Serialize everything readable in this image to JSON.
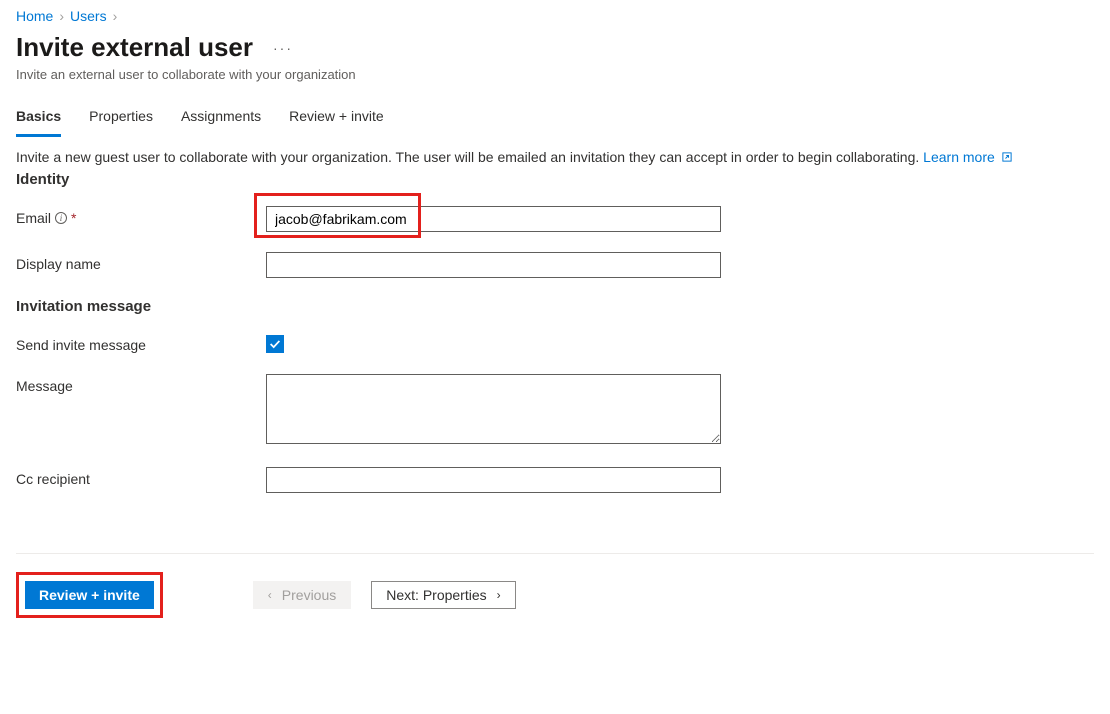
{
  "breadcrumb": {
    "home": "Home",
    "users": "Users"
  },
  "header": {
    "title": "Invite external user",
    "subtitle": "Invite an external user to collaborate with your organization"
  },
  "tabs": {
    "basics": "Basics",
    "properties": "Properties",
    "assignments": "Assignments",
    "review": "Review + invite"
  },
  "description": {
    "text": "Invite a new guest user to collaborate with your organization. The user will be emailed an invitation they can accept in order to begin collaborating.",
    "learn_more": "Learn more"
  },
  "sections": {
    "identity": "Identity",
    "invitation": "Invitation message"
  },
  "fields": {
    "email_label": "Email",
    "email_value": "jacob@fabrikam.com",
    "display_name_label": "Display name",
    "display_name_value": "",
    "send_invite_label": "Send invite message",
    "send_invite_checked": true,
    "message_label": "Message",
    "message_value": "",
    "cc_label": "Cc recipient",
    "cc_value": ""
  },
  "footer": {
    "review": "Review + invite",
    "previous": "Previous",
    "next": "Next: Properties"
  }
}
